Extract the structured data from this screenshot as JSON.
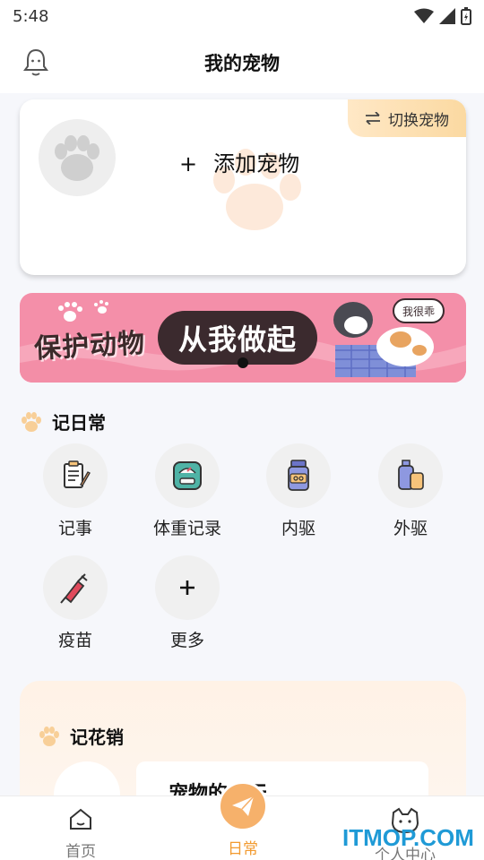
{
  "status_bar": {
    "time": "5:48"
  },
  "header": {
    "title": "我的宠物"
  },
  "pet_card": {
    "add_plus": "+",
    "add_label": "添加宠物",
    "switch_label": "切换宠物"
  },
  "banner": {
    "left_text": "保护动物",
    "pill_text": "从我做起",
    "bubble_text": "我很乖"
  },
  "daily": {
    "title": "记日常",
    "items": [
      {
        "label": "记事",
        "icon": "notebook-icon"
      },
      {
        "label": "体重记录",
        "icon": "scale-icon"
      },
      {
        "label": "内驱",
        "icon": "medicine-bottle-icon"
      },
      {
        "label": "外驱",
        "icon": "spray-bottle-icon"
      },
      {
        "label": "疫苗",
        "icon": "syringe-icon"
      },
      {
        "label": "更多",
        "icon": "plus-icon"
      }
    ]
  },
  "expense": {
    "title": "记花销",
    "card_text": "宠物的一天"
  },
  "tabbar": {
    "items": [
      {
        "label": "首页",
        "icon": "home-icon"
      },
      {
        "label": "日常",
        "icon": "paper-plane-icon"
      },
      {
        "label": "个人中心",
        "icon": "cat-face-icon"
      }
    ],
    "active": "日常"
  },
  "watermark": "ITMOP.COM",
  "colors": {
    "accent": "#f29a2e",
    "banner_pink": "#f48fa9",
    "switch_gold": "#fbd9a1"
  }
}
